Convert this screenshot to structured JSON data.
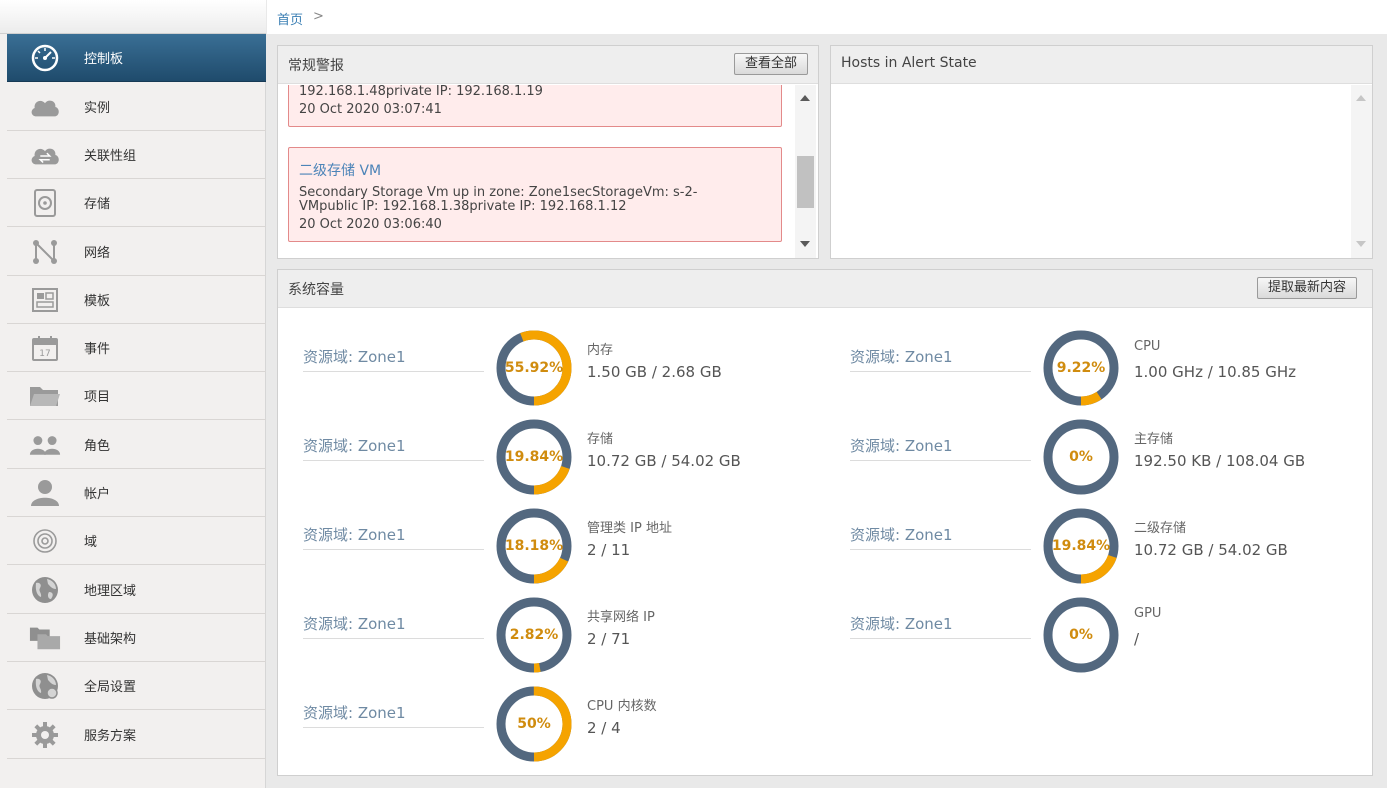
{
  "breadcrumb": {
    "home": "首页",
    "separator": ">"
  },
  "sidebar": {
    "items": [
      {
        "label": "控制板",
        "icon": "dashboard-icon",
        "active": true
      },
      {
        "label": "实例",
        "icon": "cloud-icon"
      },
      {
        "label": "关联性组",
        "icon": "cloud-sync-icon"
      },
      {
        "label": "存储",
        "icon": "disk-icon"
      },
      {
        "label": "网络",
        "icon": "network-icon"
      },
      {
        "label": "模板",
        "icon": "template-icon"
      },
      {
        "label": "事件",
        "icon": "calendar-icon"
      },
      {
        "label": "项目",
        "icon": "folder-icon"
      },
      {
        "label": "角色",
        "icon": "users-icon"
      },
      {
        "label": "帐户",
        "icon": "user-icon"
      },
      {
        "label": "域",
        "icon": "target-icon"
      },
      {
        "label": "地理区域",
        "icon": "globe-icon"
      },
      {
        "label": "基础架构",
        "icon": "folders-icon"
      },
      {
        "label": "全局设置",
        "icon": "globe-settings-icon"
      },
      {
        "label": "服务方案",
        "icon": "gear-icon"
      }
    ]
  },
  "alerts_panel": {
    "title": "常规警报",
    "view_all_label": "查看全部",
    "alerts": [
      {
        "title": "",
        "lines": [
          "192.168.1.48private IP: 192.168.1.19"
        ],
        "date": "20 Oct 2020 03:07:41"
      },
      {
        "title": "二级存储 VM",
        "lines": [
          "Secondary Storage Vm up in zone: Zone1secStorageVm: s-2-",
          "VMpublic IP: 192.168.1.38private IP: 192.168.1.12"
        ],
        "date": "20 Oct 2020 03:06:40"
      }
    ]
  },
  "hosts_panel": {
    "title": "Hosts in Alert State"
  },
  "capacity_panel": {
    "title": "系统容量",
    "fetch_label": "提取最新内容",
    "colors": {
      "used": "#f5a300",
      "free": "#53687f",
      "pct_text": "#d08c0f"
    },
    "items": [
      {
        "zone": "资源域: Zone1",
        "name": "内存",
        "value": "1.50 GB / 2.68 GB",
        "pct_label": "55.92%",
        "pct": 55.92
      },
      {
        "zone": "资源域: Zone1",
        "name": "CPU",
        "value": "1.00 GHz / 10.85 GHz",
        "pct_label": "9.22%",
        "pct": 9.22
      },
      {
        "zone": "资源域: Zone1",
        "name": "存储",
        "value": "10.72 GB / 54.02 GB",
        "pct_label": "19.84%",
        "pct": 19.84
      },
      {
        "zone": "资源域: Zone1",
        "name": "主存储",
        "value": "192.50 KB / 108.04 GB",
        "pct_label": "0%",
        "pct": 0
      },
      {
        "zone": "资源域: Zone1",
        "name": "管理类 IP 地址",
        "value": "2 / 11",
        "pct_label": "18.18%",
        "pct": 18.18
      },
      {
        "zone": "资源域: Zone1",
        "name": "二级存储",
        "value": "10.72 GB / 54.02 GB",
        "pct_label": "19.84%",
        "pct": 19.84
      },
      {
        "zone": "资源域: Zone1",
        "name": "共享网络 IP",
        "value": "2 / 71",
        "pct_label": "2.82%",
        "pct": 2.82
      },
      {
        "zone": "资源域: Zone1",
        "name": "GPU",
        "value": "/",
        "pct_label": "0%",
        "pct": 0
      },
      {
        "zone": "资源域: Zone1",
        "name": "CPU 内核数",
        "value": "2 / 4",
        "pct_label": "50%",
        "pct": 50
      }
    ]
  }
}
